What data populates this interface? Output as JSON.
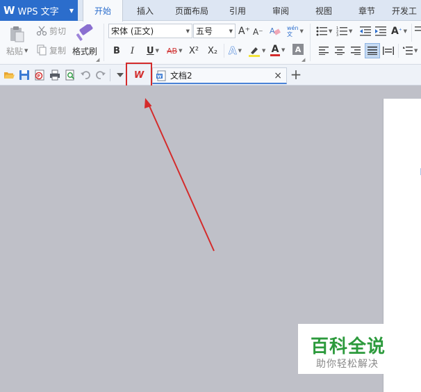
{
  "app": {
    "logo_glyph": "W",
    "title": "WPS 文字",
    "menu_arrow": "▼"
  },
  "ribbon_tabs": [
    {
      "label": "开始"
    },
    {
      "label": "插入"
    },
    {
      "label": "页面布局"
    },
    {
      "label": "引用"
    },
    {
      "label": "审阅"
    },
    {
      "label": "视图"
    },
    {
      "label": "章节"
    },
    {
      "label": "开发工"
    }
  ],
  "clipboard": {
    "paste_label": "粘贴",
    "cut_label": "剪切",
    "copy_label": "复制",
    "format_painter_label": "格式刷"
  },
  "font": {
    "family": "宋体 (正文)",
    "size": "五号",
    "grow_label": "A⁺",
    "shrink_label": "A⁻",
    "bold": "B",
    "italic": "I",
    "underline": "U",
    "strikethrough": "AB",
    "superscript": "X²",
    "subscript": "X₂",
    "effects": "A",
    "color": "A",
    "shading": "A",
    "phonetic": "wén\n文"
  },
  "paragraph": {
    "text_style_label": "A"
  },
  "document": {
    "tab_title": "文档2",
    "close_glyph": "×",
    "new_tab_glyph": "+"
  },
  "highlight": {
    "wps_icon_glyph": "W"
  },
  "watermark": {
    "main": "百科全说",
    "sub": "助你轻松解决"
  },
  "colors": {
    "app_blue": "#2b6dcc",
    "highlight_red": "#d42b2b",
    "arrow_red": "#d42b2b",
    "watermark_green": "#2c9a3c",
    "workspace_gray": "#bfc0c8"
  }
}
